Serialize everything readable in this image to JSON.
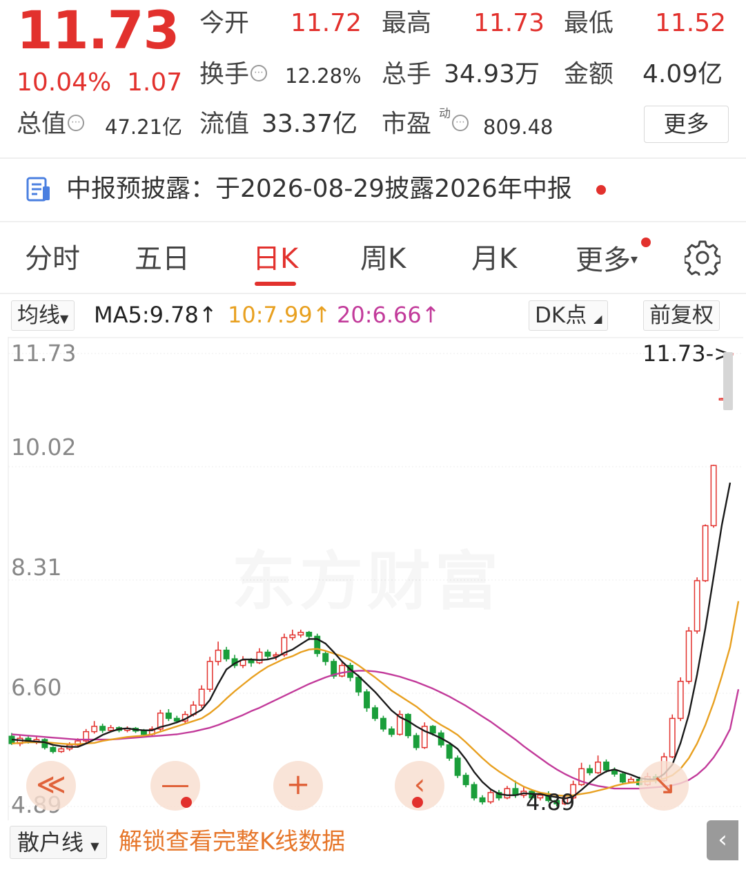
{
  "quote": {
    "price": "11.73",
    "change_pct": "10.04%",
    "change_amt": "1.07",
    "open_label": "今开",
    "open": "11.72",
    "high_label": "最高",
    "high": "11.73",
    "low_label": "最低",
    "low": "11.52",
    "turnover_label": "换手",
    "turnover": "12.28%",
    "volume_label": "总手",
    "volume": "34.93万",
    "amount_label": "金额",
    "amount": "4.09亿",
    "mktcap_label": "总值",
    "mktcap": "47.21亿",
    "float_label": "流值",
    "float_cap": "33.37亿",
    "pe_label": "市盈",
    "pe_sup": "动",
    "pe": "809.48",
    "more_label": "更多",
    "info_glyph": "⋯"
  },
  "notice": {
    "text": "中报预披露：于2026-08-29披露2026年中报"
  },
  "tabs": [
    {
      "label": "分时"
    },
    {
      "label": "五日"
    },
    {
      "label": "日K"
    },
    {
      "label": "周K"
    },
    {
      "label": "月K"
    },
    {
      "label": "更多"
    }
  ],
  "ma_row": {
    "indicator": "均线",
    "ma5": "MA5:9.78↑",
    "ma10": "10:7.99↑",
    "ma20": "20:6.66↑",
    "dk": "DK点",
    "adjust": "前复权"
  },
  "chart_data": {
    "type": "candlestick",
    "y_ticks": [
      "11.73",
      "10.02",
      "8.31",
      "6.60",
      "4.89"
    ],
    "ylim": [
      4.89,
      11.73
    ],
    "last_price_label": "11.73->",
    "min_label": "4.89",
    "watermark": "东方财富",
    "colors": {
      "up": "#e2312d",
      "down": "#1a9e3a",
      "ma5": "#1a1a1a",
      "ma10": "#e8a020",
      "ma20": "#c23a9a"
    },
    "candles": [
      [
        5.95,
        5.84,
        6.0,
        5.82
      ],
      [
        5.84,
        5.92,
        5.96,
        5.8
      ],
      [
        5.92,
        5.86,
        5.95,
        5.84
      ],
      [
        5.86,
        5.9,
        5.94,
        5.83
      ],
      [
        5.9,
        5.78,
        5.92,
        5.75
      ],
      [
        5.78,
        5.72,
        5.8,
        5.69
      ],
      [
        5.72,
        5.76,
        5.8,
        5.7
      ],
      [
        5.76,
        5.82,
        5.86,
        5.73
      ],
      [
        5.82,
        5.88,
        5.92,
        5.79
      ],
      [
        5.88,
        6.02,
        6.06,
        5.85
      ],
      [
        6.02,
        6.1,
        6.18,
        5.99
      ],
      [
        6.1,
        6.04,
        6.14,
        6.0
      ],
      [
        6.04,
        6.08,
        6.12,
        6.02
      ],
      [
        6.08,
        6.04,
        6.1,
        6.01
      ],
      [
        6.04,
        6.07,
        6.1,
        6.01
      ],
      [
        6.07,
        6.03,
        6.09,
        6.0
      ],
      [
        6.03,
        5.98,
        6.06,
        5.95
      ],
      [
        5.98,
        6.06,
        6.1,
        5.95
      ],
      [
        6.06,
        6.3,
        6.35,
        6.03
      ],
      [
        6.3,
        6.22,
        6.36,
        6.18
      ],
      [
        6.22,
        6.18,
        6.26,
        6.15
      ],
      [
        6.18,
        6.28,
        6.33,
        6.15
      ],
      [
        6.28,
        6.42,
        6.48,
        6.25
      ],
      [
        6.42,
        6.66,
        6.72,
        6.38
      ],
      [
        6.66,
        7.08,
        7.15,
        6.62
      ],
      [
        7.08,
        7.25,
        7.38,
        7.02
      ],
      [
        7.25,
        7.12,
        7.3,
        7.08
      ],
      [
        7.12,
        7.02,
        7.18,
        6.98
      ],
      [
        7.02,
        7.1,
        7.16,
        6.98
      ],
      [
        7.1,
        7.06,
        7.13,
        7.0
      ],
      [
        7.06,
        7.22,
        7.28,
        7.04
      ],
      [
        7.22,
        7.16,
        7.26,
        7.12
      ],
      [
        7.16,
        7.18,
        7.22,
        7.1
      ],
      [
        7.18,
        7.44,
        7.5,
        7.15
      ],
      [
        7.44,
        7.48,
        7.56,
        7.4
      ],
      [
        7.48,
        7.52,
        7.56,
        7.44
      ],
      [
        7.52,
        7.46,
        7.54,
        7.4
      ],
      [
        7.46,
        7.2,
        7.5,
        7.15
      ],
      [
        7.2,
        7.08,
        7.25,
        7.02
      ],
      [
        7.08,
        6.86,
        7.12,
        6.82
      ],
      [
        6.86,
        7.02,
        7.08,
        6.84
      ],
      [
        7.02,
        6.84,
        7.06,
        6.78
      ],
      [
        6.84,
        6.62,
        6.88,
        6.56
      ],
      [
        6.62,
        6.38,
        6.66,
        6.32
      ],
      [
        6.38,
        6.22,
        6.42,
        6.18
      ],
      [
        6.22,
        6.06,
        6.26,
        6.02
      ],
      [
        6.06,
        5.98,
        6.1,
        5.94
      ],
      [
        5.98,
        6.28,
        6.34,
        5.96
      ],
      [
        6.28,
        5.96,
        6.3,
        5.92
      ],
      [
        5.96,
        5.78,
        6.0,
        5.74
      ],
      [
        5.78,
        6.1,
        6.16,
        5.76
      ],
      [
        6.1,
        6.0,
        6.12,
        5.96
      ],
      [
        6.0,
        5.82,
        6.04,
        5.78
      ],
      [
        5.82,
        5.62,
        5.86,
        5.58
      ],
      [
        5.62,
        5.36,
        5.66,
        5.32
      ],
      [
        5.36,
        5.22,
        5.4,
        5.18
      ],
      [
        5.22,
        5.02,
        5.26,
        4.98
      ],
      [
        5.02,
        4.96,
        5.06,
        4.92
      ],
      [
        4.96,
        5.1,
        5.14,
        4.93
      ],
      [
        5.1,
        5.02,
        5.14,
        4.98
      ],
      [
        5.02,
        5.16,
        5.2,
        5.0
      ],
      [
        5.16,
        5.06,
        5.28,
        5.02
      ],
      [
        5.06,
        5.12,
        5.18,
        5.02
      ],
      [
        5.12,
        5.02,
        5.15,
        4.99
      ],
      [
        5.02,
        5.06,
        5.1,
        4.98
      ],
      [
        5.06,
        4.98,
        5.12,
        4.95
      ],
      [
        4.98,
        4.93,
        5.0,
        4.89
      ],
      [
        4.93,
        5.02,
        5.05,
        4.91
      ],
      [
        5.02,
        5.22,
        5.28,
        5.0
      ],
      [
        5.22,
        5.46,
        5.55,
        5.2
      ],
      [
        5.46,
        5.4,
        5.52,
        5.36
      ],
      [
        5.4,
        5.56,
        5.66,
        5.38
      ],
      [
        5.56,
        5.44,
        5.6,
        5.4
      ],
      [
        5.44,
        5.38,
        5.48,
        5.34
      ],
      [
        5.38,
        5.26,
        5.42,
        5.22
      ],
      [
        5.26,
        5.3,
        5.34,
        5.24
      ],
      [
        5.3,
        5.22,
        5.34,
        5.2
      ],
      [
        5.22,
        5.34,
        5.4,
        5.2
      ],
      [
        5.34,
        5.28,
        5.38,
        5.24
      ],
      [
        5.28,
        5.64,
        5.7,
        5.26
      ],
      [
        5.64,
        6.22,
        6.28,
        5.62
      ],
      [
        6.22,
        6.78,
        6.84,
        6.18
      ],
      [
        6.78,
        7.54,
        7.6,
        6.74
      ],
      [
        7.54,
        8.3,
        8.35,
        7.5
      ],
      [
        8.3,
        9.13,
        9.15,
        8.28
      ],
      [
        9.13,
        10.04,
        10.05,
        9.1
      ],
      [
        11.05,
        11.05,
        11.06,
        11.04
      ],
      [
        11.72,
        11.73,
        11.73,
        11.52
      ]
    ],
    "ma5": [
      5.9,
      5.89,
      5.88,
      5.87,
      5.86,
      5.82,
      5.8,
      5.79,
      5.79,
      5.84,
      5.9,
      5.97,
      6.02,
      6.06,
      6.07,
      6.05,
      6.04,
      6.04,
      6.09,
      6.12,
      6.16,
      6.21,
      6.28,
      6.35,
      6.5,
      6.74,
      6.96,
      7.05,
      7.11,
      7.11,
      7.1,
      7.11,
      7.14,
      7.21,
      7.26,
      7.34,
      7.42,
      7.42,
      7.35,
      7.22,
      7.08,
      6.96,
      6.86,
      6.74,
      6.62,
      6.48,
      6.34,
      6.24,
      6.18,
      6.1,
      6.03,
      5.98,
      5.92,
      5.85,
      5.76,
      5.6,
      5.41,
      5.26,
      5.15,
      5.08,
      5.06,
      5.06,
      5.09,
      5.08,
      5.08,
      5.05,
      5.03,
      5.01,
      5.04,
      5.14,
      5.25,
      5.35,
      5.42,
      5.45,
      5.41,
      5.37,
      5.32,
      5.3,
      5.3,
      5.38,
      5.52,
      5.85,
      6.28,
      6.88,
      7.58,
      8.36,
      9.14,
      9.78
    ],
    "ma10": [
      5.84,
      5.85,
      5.86,
      5.86,
      5.86,
      5.85,
      5.84,
      5.83,
      5.83,
      5.84,
      5.85,
      5.88,
      5.9,
      5.92,
      5.94,
      5.95,
      5.96,
      5.98,
      6.02,
      6.06,
      6.1,
      6.14,
      6.18,
      6.22,
      6.3,
      6.4,
      6.52,
      6.63,
      6.73,
      6.83,
      6.92,
      7.0,
      7.06,
      7.12,
      7.16,
      7.22,
      7.26,
      7.27,
      7.24,
      7.2,
      7.16,
      7.1,
      7.02,
      6.93,
      6.84,
      6.74,
      6.64,
      6.56,
      6.48,
      6.4,
      6.3,
      6.2,
      6.12,
      6.05,
      5.97,
      5.86,
      5.74,
      5.62,
      5.51,
      5.42,
      5.34,
      5.26,
      5.19,
      5.14,
      5.1,
      5.08,
      5.06,
      5.05,
      5.06,
      5.08,
      5.1,
      5.13,
      5.16,
      5.2,
      5.23,
      5.25,
      5.26,
      5.27,
      5.28,
      5.31,
      5.36,
      5.46,
      5.62,
      5.84,
      6.12,
      6.46,
      6.86,
      7.3,
      7.99
    ],
    "ma20": [
      5.98,
      5.97,
      5.96,
      5.95,
      5.94,
      5.93,
      5.92,
      5.91,
      5.9,
      5.9,
      5.9,
      5.9,
      5.9,
      5.91,
      5.92,
      5.93,
      5.94,
      5.95,
      5.96,
      5.97,
      5.98,
      6.0,
      6.02,
      6.05,
      6.08,
      6.12,
      6.17,
      6.22,
      6.27,
      6.33,
      6.38,
      6.44,
      6.5,
      6.56,
      6.62,
      6.68,
      6.74,
      6.79,
      6.84,
      6.88,
      6.91,
      6.93,
      6.94,
      6.94,
      6.93,
      6.91,
      6.88,
      6.85,
      6.81,
      6.77,
      6.72,
      6.67,
      6.61,
      6.55,
      6.48,
      6.41,
      6.33,
      6.25,
      6.17,
      6.08,
      5.99,
      5.9,
      5.8,
      5.71,
      5.62,
      5.53,
      5.45,
      5.38,
      5.32,
      5.27,
      5.23,
      5.2,
      5.18,
      5.16,
      5.16,
      5.16,
      5.16,
      5.17,
      5.18,
      5.19,
      5.21,
      5.24,
      5.29,
      5.37,
      5.48,
      5.63,
      5.82,
      6.06,
      6.66
    ]
  },
  "zoom_controls": [
    {
      "glyph": "≪"
    },
    {
      "glyph": "—"
    },
    {
      "glyph": "+"
    },
    {
      "glyph": "‹"
    },
    {
      "glyph": "↘"
    }
  ],
  "bottom": {
    "indicator": "散户线",
    "unlock": "解锁查看完整K线数据",
    "side_arrow": "‹"
  }
}
